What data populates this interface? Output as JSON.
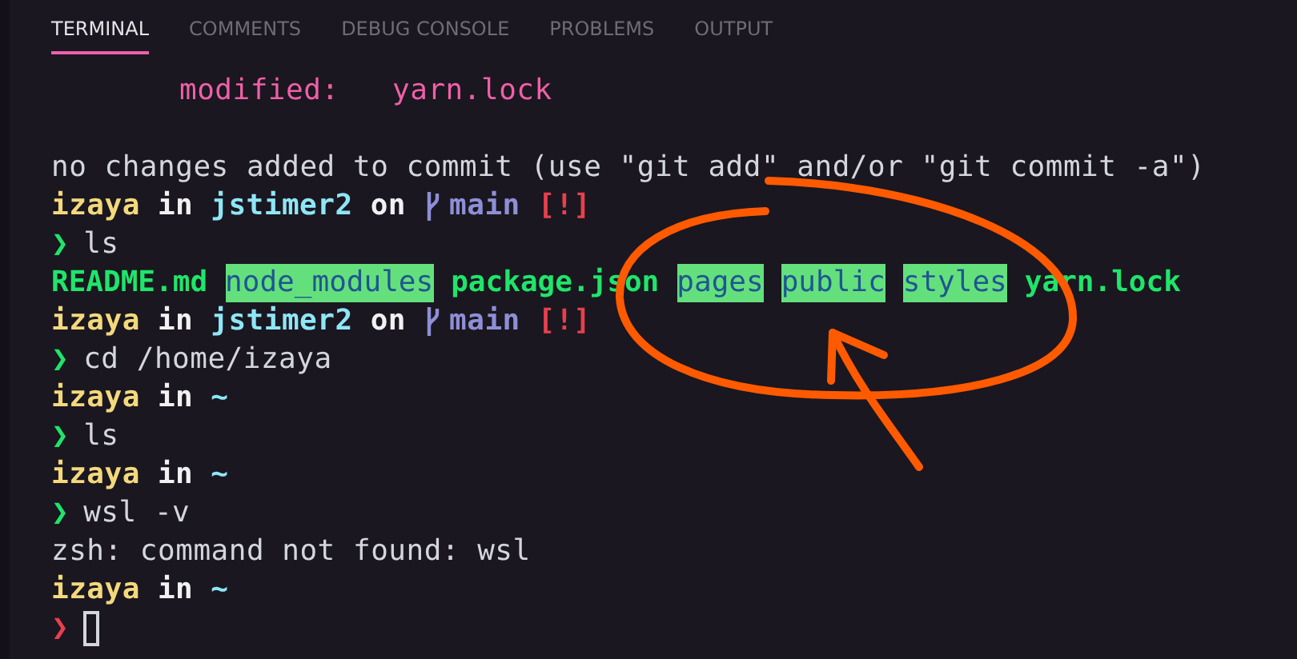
{
  "tabs": [
    {
      "label": "TERMINAL",
      "selected": true
    },
    {
      "label": "COMMENTS",
      "selected": false
    },
    {
      "label": "DEBUG CONSOLE",
      "selected": false
    },
    {
      "label": "PROBLEMS",
      "selected": false
    },
    {
      "label": "OUTPUT",
      "selected": false
    }
  ],
  "terminal": {
    "lines": [
      {
        "kind": "status",
        "text": "modified:   yarn.lock"
      },
      {
        "kind": "blank"
      },
      {
        "kind": "output",
        "text": "no changes added to commit (use \"git add\" and/or \"git commit -a\")"
      },
      {
        "kind": "prompt",
        "user": "izaya",
        "in_word": "in",
        "directory": "jstimer2",
        "on_word": "on",
        "branch": "main",
        "git_status": "[!]"
      },
      {
        "kind": "command",
        "symbol": "❯",
        "success": true,
        "text": "ls"
      },
      {
        "kind": "listing",
        "entries": [
          {
            "name": "README.md",
            "kind": "file"
          },
          {
            "name": "node_modules",
            "kind": "dir"
          },
          {
            "name": "package.json",
            "kind": "file"
          },
          {
            "name": "pages",
            "kind": "dir"
          },
          {
            "name": "public",
            "kind": "dir"
          },
          {
            "name": "styles",
            "kind": "dir"
          },
          {
            "name": "yarn.lock",
            "kind": "file"
          }
        ]
      },
      {
        "kind": "prompt",
        "user": "izaya",
        "in_word": "in",
        "directory": "jstimer2",
        "on_word": "on",
        "branch": "main",
        "git_status": "[!]"
      },
      {
        "kind": "command",
        "symbol": "❯",
        "success": true,
        "text": "cd /home/izaya"
      },
      {
        "kind": "prompt",
        "user": "izaya",
        "in_word": "in",
        "directory": "~"
      },
      {
        "kind": "command",
        "symbol": "❯",
        "success": true,
        "text": "ls"
      },
      {
        "kind": "prompt",
        "user": "izaya",
        "in_word": "in",
        "directory": "~"
      },
      {
        "kind": "command",
        "symbol": "❯",
        "success": true,
        "text": "wsl -v"
      },
      {
        "kind": "output",
        "text": "zsh: command not found: wsl"
      },
      {
        "kind": "prompt",
        "user": "izaya",
        "in_word": "in",
        "directory": "~"
      },
      {
        "kind": "command",
        "symbol": "❯",
        "success": false,
        "cursor": true
      }
    ]
  }
}
